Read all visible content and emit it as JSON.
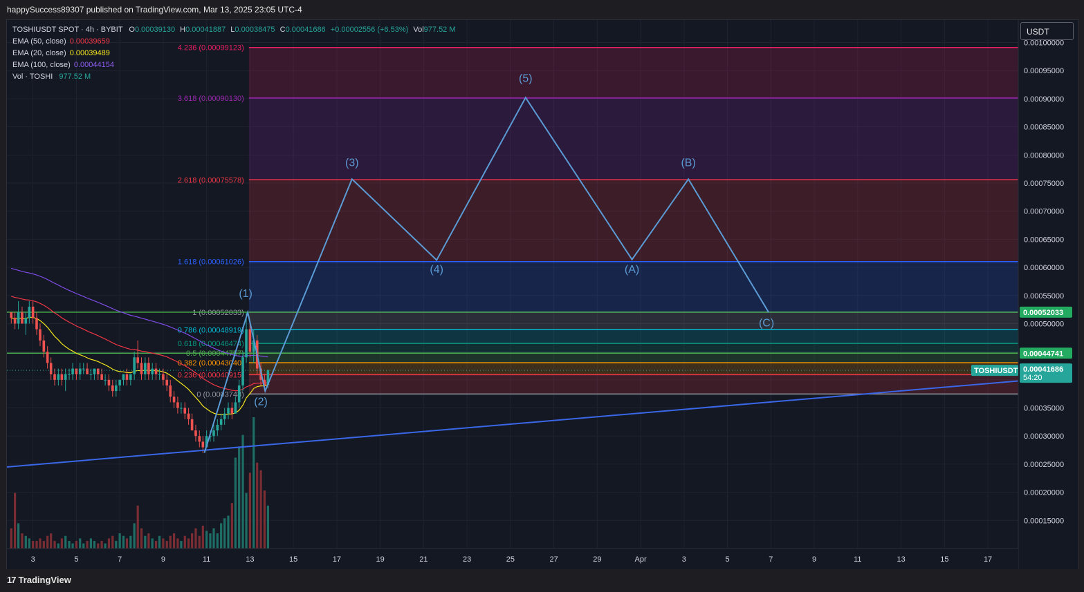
{
  "header": {
    "publisher_line": "happySuccess89307 published on TradingView.com, Mar 13, 2025 23:05 UTC-4"
  },
  "legend": {
    "symbol": "TOSHIUSDT SPOT · 4h · BYBIT",
    "o_label": "O",
    "o_value": "0.00039130",
    "h_label": "H",
    "h_value": "0.00041887",
    "l_label": "L",
    "l_value": "0.00038475",
    "c_label": "C",
    "c_value": "0.00041686",
    "change": "+0.00002556 (+6.53%)",
    "vol_label": "Vol",
    "vol_value": "977.52 M",
    "ema50_label": "EMA (50, close)",
    "ema50_value": "0.00039659",
    "ema20_label": "EMA (20, close)",
    "ema20_value": "0.00039489",
    "ema100_label": "EMA (100, close)",
    "ema100_value": "0.00044154",
    "vol_ind_label": "Vol · TOSHI",
    "vol_ind_value": "977.52 M"
  },
  "currency_button": "USDT",
  "branding": {
    "logo_text": "TradingView",
    "logo_mark": "17"
  },
  "colors": {
    "ema50": "#f23645",
    "ema20": "#f5e71c",
    "ema100": "#7e4ce6",
    "wave": "#5b9bd5",
    "trendline": "#3a67e8",
    "up": "#26a69a",
    "down": "#ef5350",
    "last_price_bg": "#26a69a",
    "fib_1_bg": "#22ab61"
  },
  "chart_data": {
    "type": "candlestick",
    "symbol": "TOSHIUSDT",
    "interval": "4h",
    "y_axis": {
      "range": [
        0.0001,
        0.00104
      ],
      "ticks": [
        0.00015,
        0.0002,
        0.00025,
        0.0003,
        0.00035,
        0.0004,
        0.00045,
        0.0005,
        0.00055,
        0.0006,
        0.00065,
        0.0007,
        0.00075,
        0.0008,
        0.00085,
        0.0009,
        0.00095,
        0.001
      ],
      "tick_labels": [
        "0.00015000",
        "0.00020000",
        "0.00025000",
        "0.00030000",
        "0.00035000",
        "0.00040000",
        "0.00045000",
        "0.00050000",
        "0.00055000",
        "0.00060000",
        "0.00065000",
        "0.00070000",
        "0.00075000",
        "0.00080000",
        "0.00085000",
        "0.00090000",
        "0.00095000",
        "0.00100000"
      ]
    },
    "x_axis": {
      "tick_labels": [
        "3",
        "5",
        "7",
        "9",
        "11",
        "13",
        "15",
        "17",
        "19",
        "21",
        "23",
        "25",
        "27",
        "29",
        "Apr",
        "3",
        "5",
        "7",
        "9",
        "11",
        "13",
        "15",
        "17"
      ],
      "tick_days": [
        3,
        5,
        7,
        9,
        11,
        13,
        15,
        17,
        19,
        21,
        23,
        25,
        27,
        29,
        31,
        33,
        35,
        37,
        39,
        41,
        43,
        45,
        47
      ],
      "range_days": [
        1.8,
        48.4
      ]
    },
    "fib_levels": [
      {
        "ratio": "0",
        "price": 0.0003748,
        "label": "0 (0.0003748)",
        "color": "#9598a1"
      },
      {
        "ratio": "0.236",
        "price": 0.00040915,
        "label": "0.236 (0.00040915)",
        "color": "#f23645"
      },
      {
        "ratio": "0.382",
        "price": 0.0004304,
        "label": "0.382 (0.00043040)",
        "color": "#ff9800"
      },
      {
        "ratio": "0.5",
        "price": 0.00044757,
        "label": "0.5 (0.00044757)",
        "color": "#4caf50"
      },
      {
        "ratio": "0.618",
        "price": 0.00046474,
        "label": "0.618 (0.00046474)",
        "color": "#089981"
      },
      {
        "ratio": "0.786",
        "price": 0.00048919,
        "label": "0.786 (0.00048919)",
        "color": "#00bcd4"
      },
      {
        "ratio": "1",
        "price": 0.00052033,
        "label": "1 (0.00052033)",
        "color": "#9598a1"
      },
      {
        "ratio": "1.618",
        "price": 0.00061026,
        "label": "1.618 (0.00061026)",
        "color": "#2962ff"
      },
      {
        "ratio": "2.618",
        "price": 0.00075578,
        "label": "2.618 (0.00075578)",
        "color": "#f23645"
      },
      {
        "ratio": "3.618",
        "price": 0.0009013,
        "label": "3.618 (0.00090130)",
        "color": "#9c27b0"
      },
      {
        "ratio": "4.236",
        "price": 0.00099123,
        "label": "4.236 (0.00099123)",
        "color": "#e91e63"
      }
    ],
    "price_labels": [
      {
        "text": "0.00052033",
        "price": 0.00052033,
        "bg": "#22ab61"
      },
      {
        "text": "0.00044741",
        "price": 0.00044741,
        "bg": "#22ab61"
      },
      {
        "text": "0.00041686",
        "sub": "54:20",
        "price": 0.00041686,
        "bg": "#26a69a",
        "tag": "TOSHIUSDT"
      }
    ],
    "horizontal_lines": [
      {
        "price": 0.00052033,
        "color": "#4caf50"
      },
      {
        "price": 0.00044741,
        "color": "#4caf50"
      }
    ],
    "elliott_wave": {
      "points": [
        {
          "day": 10.9,
          "price": 0.00027
        },
        {
          "day": 12.9,
          "price": 0.00052
        },
        {
          "day": 13.7,
          "price": 0.00038
        },
        {
          "day": 17.7,
          "price": 0.000757
        },
        {
          "day": 21.6,
          "price": 0.000613
        },
        {
          "day": 25.7,
          "price": 0.000902
        },
        {
          "day": 30.6,
          "price": 0.000614
        },
        {
          "day": 33.2,
          "price": 0.000757
        },
        {
          "day": 36.9,
          "price": 0.00052
        }
      ],
      "labels": [
        {
          "text": "(1)",
          "day": 12.8,
          "price": 0.000547,
          "color": "#5b9bd5"
        },
        {
          "text": "(2)",
          "day": 13.5,
          "price": 0.000355,
          "color": "#5b9bd5"
        },
        {
          "text": "(3)",
          "day": 17.7,
          "price": 0.00078,
          "color": "#5b9bd5"
        },
        {
          "text": "(4)",
          "day": 21.6,
          "price": 0.00059,
          "color": "#5b9bd5"
        },
        {
          "text": "(5)",
          "day": 25.7,
          "price": 0.00093,
          "color": "#5b9bd5"
        },
        {
          "text": "(A)",
          "day": 30.6,
          "price": 0.00059,
          "color": "#5b9bd5"
        },
        {
          "text": "(B)",
          "day": 33.2,
          "price": 0.00078,
          "color": "#5b9bd5"
        },
        {
          "text": "(C)",
          "day": 36.8,
          "price": 0.000495,
          "color": "#5b9bd5"
        }
      ]
    },
    "trendline": {
      "start": {
        "day": 1.8,
        "price": 0.000245
      },
      "end": {
        "day": 48.4,
        "price": 0.000398
      }
    },
    "candles": [
      [
        2.0,
        0.00052,
        0.00052,
        0.0005,
        0.00051
      ],
      [
        2.17,
        0.00051,
        0.00052,
        0.00049,
        0.0005
      ],
      [
        2.33,
        0.0005,
        0.00054,
        0.00049,
        0.00052
      ],
      [
        2.5,
        0.00052,
        0.00053,
        0.0005,
        0.0005
      ],
      [
        2.67,
        0.0005,
        0.00052,
        0.00048,
        0.00051
      ],
      [
        2.83,
        0.00051,
        0.00054,
        0.0005,
        0.00053
      ],
      [
        3.0,
        0.00053,
        0.00054,
        0.0005,
        0.00051
      ],
      [
        3.17,
        0.00051,
        0.00052,
        0.00048,
        0.00049
      ],
      [
        3.33,
        0.00049,
        0.0005,
        0.00046,
        0.00047
      ],
      [
        3.5,
        0.00047,
        0.00048,
        0.00044,
        0.00045
      ],
      [
        3.67,
        0.00045,
        0.00046,
        0.00042,
        0.00043
      ],
      [
        3.83,
        0.00043,
        0.00044,
        0.0004,
        0.00041
      ],
      [
        4.0,
        0.00041,
        0.00042,
        0.00039,
        0.0004
      ],
      [
        4.17,
        0.0004,
        0.00042,
        0.00039,
        0.00041
      ],
      [
        4.33,
        0.00041,
        0.00042,
        0.00039,
        0.0004
      ],
      [
        4.5,
        0.0004,
        0.00042,
        0.00038,
        0.00041
      ],
      [
        4.67,
        0.00041,
        0.00042,
        0.0004,
        0.00041
      ],
      [
        4.83,
        0.00041,
        0.00043,
        0.0004,
        0.00042
      ],
      [
        5.0,
        0.00042,
        0.00042,
        0.0004,
        0.00041
      ],
      [
        5.17,
        0.00041,
        0.00043,
        0.0004,
        0.00042
      ],
      [
        5.33,
        0.00042,
        0.00043,
        0.00041,
        0.00042
      ],
      [
        5.5,
        0.00042,
        0.00043,
        0.00041,
        0.00041
      ],
      [
        5.67,
        0.00041,
        0.00042,
        0.0004,
        0.00041
      ],
      [
        5.83,
        0.00041,
        0.00042,
        0.0004,
        0.00042
      ],
      [
        6.0,
        0.00042,
        0.00042,
        0.0004,
        0.00041
      ],
      [
        6.17,
        0.00041,
        0.00042,
        0.0004,
        0.0004
      ],
      [
        6.33,
        0.0004,
        0.00041,
        0.00039,
        0.0004
      ],
      [
        6.5,
        0.0004,
        0.00041,
        0.00038,
        0.00039
      ],
      [
        6.67,
        0.00039,
        0.0004,
        0.00037,
        0.00038
      ],
      [
        6.83,
        0.00038,
        0.0004,
        0.00037,
        0.00039
      ],
      [
        7.0,
        0.00039,
        0.0004,
        0.00038,
        0.0004
      ],
      [
        7.17,
        0.0004,
        0.00041,
        0.00039,
        0.00041
      ],
      [
        7.33,
        0.00041,
        0.00042,
        0.00039,
        0.0004
      ],
      [
        7.5,
        0.0004,
        0.00041,
        0.00039,
        0.00041
      ],
      [
        7.67,
        0.00041,
        0.00045,
        0.0004,
        0.00044
      ],
      [
        7.83,
        0.00044,
        0.00047,
        0.00042,
        0.00043
      ],
      [
        8.0,
        0.00043,
        0.00044,
        0.0004,
        0.00041
      ],
      [
        8.17,
        0.00041,
        0.00044,
        0.0004,
        0.00043
      ],
      [
        8.33,
        0.00043,
        0.00044,
        0.0004,
        0.00041
      ],
      [
        8.5,
        0.00041,
        0.00043,
        0.0004,
        0.00042
      ],
      [
        8.67,
        0.00042,
        0.00043,
        0.0004,
        0.00041
      ],
      [
        8.83,
        0.00041,
        0.00042,
        0.0004,
        0.00041
      ],
      [
        9.0,
        0.00041,
        0.00042,
        0.00039,
        0.0004
      ],
      [
        9.17,
        0.0004,
        0.00041,
        0.00038,
        0.00039
      ],
      [
        9.33,
        0.00039,
        0.0004,
        0.00036,
        0.00037
      ],
      [
        9.5,
        0.00037,
        0.00038,
        0.00035,
        0.00036
      ],
      [
        9.67,
        0.00036,
        0.00037,
        0.00034,
        0.00035
      ],
      [
        9.83,
        0.00035,
        0.00036,
        0.00034,
        0.00035
      ],
      [
        10.0,
        0.00035,
        0.00036,
        0.00033,
        0.00034
      ],
      [
        10.17,
        0.00034,
        0.00035,
        0.00032,
        0.00033
      ],
      [
        10.33,
        0.00033,
        0.00034,
        0.00031,
        0.00031
      ],
      [
        10.5,
        0.00031,
        0.00032,
        0.00029,
        0.0003
      ],
      [
        10.67,
        0.0003,
        0.00031,
        0.00028,
        0.00029
      ],
      [
        10.83,
        0.00029,
        0.0003,
        0.00027,
        0.00028
      ],
      [
        11.0,
        0.00028,
        0.00031,
        0.00028,
        0.0003
      ],
      [
        11.17,
        0.0003,
        0.00031,
        0.00029,
        0.0003
      ],
      [
        11.33,
        0.0003,
        0.00032,
        0.00029,
        0.00031
      ],
      [
        11.5,
        0.00031,
        0.00033,
        0.0003,
        0.00032
      ],
      [
        11.67,
        0.00032,
        0.00034,
        0.00031,
        0.00033
      ],
      [
        11.83,
        0.00033,
        0.00035,
        0.00032,
        0.00034
      ],
      [
        12.0,
        0.00034,
        0.00036,
        0.00033,
        0.00035
      ],
      [
        12.17,
        0.00035,
        0.00036,
        0.00033,
        0.00034
      ],
      [
        12.33,
        0.00034,
        0.00037,
        0.00034,
        0.00036
      ],
      [
        12.5,
        0.00036,
        0.0004,
        0.00035,
        0.00039
      ],
      [
        12.67,
        0.00039,
        0.00045,
        0.00038,
        0.00044
      ],
      [
        12.83,
        0.00044,
        0.00052,
        0.00043,
        0.00049
      ],
      [
        13.0,
        0.00049,
        0.0005,
        0.00044,
        0.00045
      ],
      [
        13.17,
        0.00045,
        0.00049,
        0.00043,
        0.00047
      ],
      [
        13.33,
        0.00047,
        0.00048,
        0.00041,
        0.00042
      ],
      [
        13.5,
        0.00042,
        0.00043,
        0.00039,
        0.0004
      ],
      [
        13.67,
        0.0004,
        0.00041,
        0.00038,
        0.00039
      ],
      [
        13.83,
        0.0003913,
        0.00041887,
        0.00038475,
        0.00041686
      ]
    ],
    "volume": [
      0.08,
      0.22,
      0.1,
      0.06,
      0.05,
      0.04,
      0.03,
      0.03,
      0.04,
      0.03,
      0.05,
      0.06,
      0.03,
      0.02,
      0.04,
      0.05,
      0.03,
      0.02,
      0.03,
      0.04,
      0.02,
      0.03,
      0.04,
      0.03,
      0.02,
      0.03,
      0.02,
      0.04,
      0.05,
      0.03,
      0.06,
      0.05,
      0.04,
      0.05,
      0.1,
      0.17,
      0.08,
      0.05,
      0.06,
      0.04,
      0.03,
      0.05,
      0.04,
      0.03,
      0.05,
      0.06,
      0.04,
      0.03,
      0.05,
      0.04,
      0.06,
      0.08,
      0.05,
      0.09,
      0.07,
      0.06,
      0.08,
      0.06,
      0.1,
      0.12,
      0.13,
      0.18,
      0.36,
      0.4,
      0.45,
      0.22,
      0.3,
      0.52,
      0.34,
      0.31,
      0.23,
      0.17
    ]
  }
}
